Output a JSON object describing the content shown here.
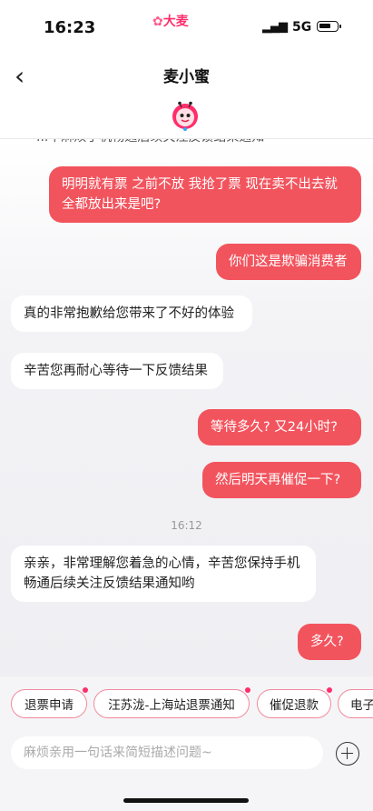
{
  "status_bar": {
    "time": "16:23",
    "logo": "大麦",
    "network": "5G",
    "signal_icon": "signal-bars-icon",
    "battery_icon": "battery-icon"
  },
  "header": {
    "title": "麦小蜜",
    "back_icon": "back-chevron-icon",
    "avatar": "mascot-avatar"
  },
  "chat": {
    "clipped_message": "...中麻烦手机畅通后续关注反馈结果通知",
    "messages": [
      {
        "side": "out",
        "text": "明明就有票 之前不放 我抢了票 现在卖不出去就全都放出来是吧?"
      },
      {
        "side": "out",
        "text": "你们这是欺骗消费者"
      },
      {
        "side": "in",
        "text": "真的非常抱歉给您带来了不好的体验"
      },
      {
        "side": "in",
        "text": "辛苦您再耐心等待一下反馈结果"
      },
      {
        "side": "out",
        "text": "等待多久? 又24小时?"
      },
      {
        "side": "out",
        "text": "然后明天再催促一下?"
      },
      {
        "side": "in",
        "text": "亲亲，非常理解您着急的心情，辛苦您保持手机畅通后续关注反馈结果通知哟"
      },
      {
        "side": "out",
        "text": "多久?"
      }
    ],
    "timestamp": "16:12"
  },
  "quick_replies": [
    "退票申请",
    "汪苏泷-上海站退票通知",
    "催促退款",
    "电子"
  ],
  "input": {
    "placeholder": "麻烦亲用一句话来简短描述问题~",
    "value": "",
    "add_icon": "plus-circle-icon"
  },
  "colors": {
    "outgoing_bubble": "#f2545e",
    "incoming_bubble": "#ffffff",
    "accent": "#ff2e6b"
  }
}
